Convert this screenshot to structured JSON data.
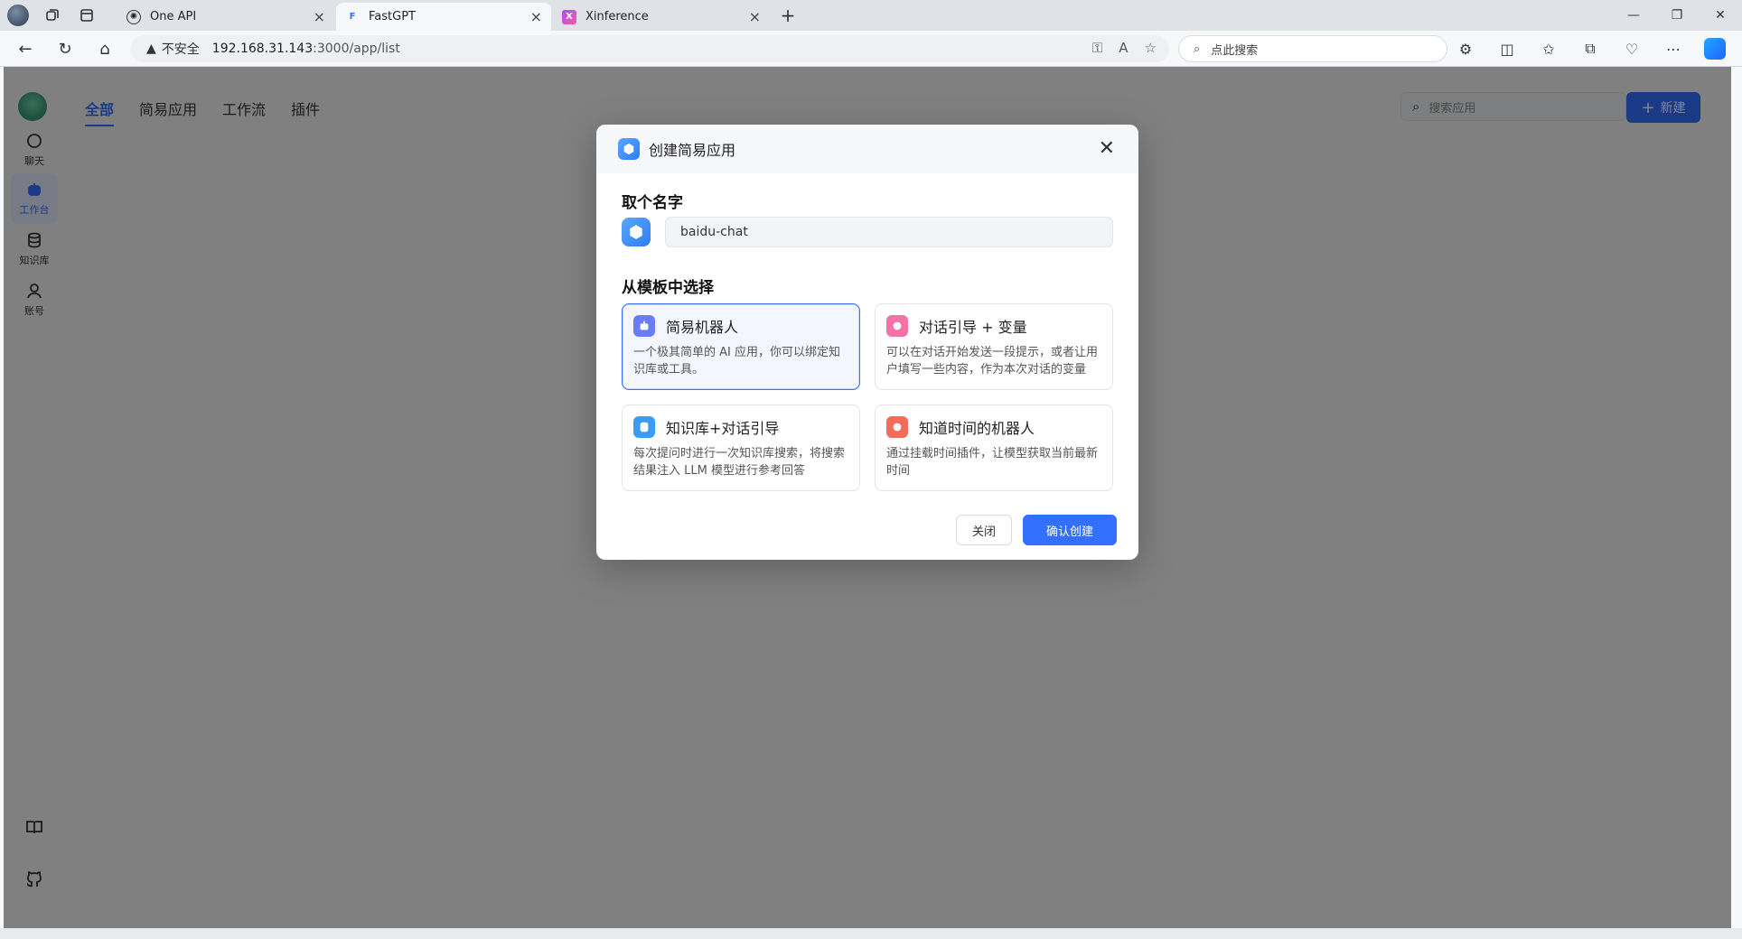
{
  "browser": {
    "tabs": [
      {
        "title": "One API",
        "icon": "openai-icon"
      },
      {
        "title": "FastGPT",
        "icon": "fastgpt-icon"
      },
      {
        "title": "Xinference",
        "icon": "xinference-icon"
      }
    ],
    "address": {
      "security": "不安全",
      "url_host": "192.168.31.143",
      "url_rest": ":3000/app/list"
    },
    "search_placeholder": "点此搜索"
  },
  "app": {
    "sidebar": [
      {
        "label": "聊天",
        "icon": "chat-icon"
      },
      {
        "label": "工作台",
        "icon": "robot-icon"
      },
      {
        "label": "知识库",
        "icon": "database-icon"
      },
      {
        "label": "账号",
        "icon": "user-icon"
      }
    ],
    "nav_tabs": [
      "全部",
      "简易应用",
      "工作流",
      "插件"
    ],
    "search_placeholder": "搜索应用",
    "new_button": "新建"
  },
  "modal": {
    "title": "创建简易应用",
    "name_section": "取个名字",
    "name_value": "baidu-chat",
    "template_section": "从模板中选择",
    "templates": [
      {
        "title": "简易机器人",
        "desc": "一个极其简单的 AI 应用，你可以绑定知识库或工具。",
        "color": "#6b7cf7",
        "selected": true
      },
      {
        "title": "对话引导 + 变量",
        "desc": "可以在对话开始发送一段提示，或者让用户填写一些内容，作为本次对话的变量",
        "color": "#f472a8",
        "selected": false
      },
      {
        "title": "知识库+对话引导",
        "desc": "每次提问时进行一次知识库搜索，将搜索结果注入 LLM 模型进行参考回答",
        "color": "#3b9cf6",
        "selected": false
      },
      {
        "title": "知道时间的机器人",
        "desc": "通过挂载时间插件，让模型获取当前最新时间",
        "color": "#f26b5b",
        "selected": false
      }
    ],
    "close_button": "关闭",
    "confirm_button": "确认创建"
  },
  "colors": {
    "accent": "#3370ff"
  }
}
